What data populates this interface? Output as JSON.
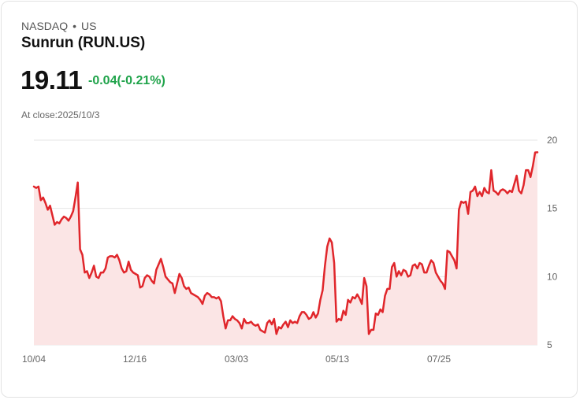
{
  "header": {
    "exchange": "NASDAQ",
    "separator": "•",
    "market": "US",
    "title": "Sunrun (RUN.US)",
    "price": "19.11",
    "change": "-0.04(-0.21%)",
    "close_label": "At close:2025/10/3"
  },
  "colors": {
    "line": "#e0262b",
    "fill": "#fbe5e5",
    "change": "#1fa34a",
    "grid": "#e6e6e6"
  },
  "chart_data": {
    "type": "area",
    "title": "",
    "xlabel": "",
    "ylabel": "",
    "ylim": [
      5,
      20
    ],
    "y_ticks": [
      "20",
      "15",
      "10",
      "5"
    ],
    "x_tick_labels": [
      "10/04",
      "12/16",
      "03/03",
      "05/13",
      "07/25"
    ],
    "grid": true,
    "axis_position": "right",
    "series": [
      {
        "values": [
          16.6,
          16.5,
          16.6,
          15.6,
          15.8,
          15.4,
          14.9,
          15.2,
          14.5,
          13.8,
          14.0,
          13.9,
          14.2,
          14.4,
          14.3,
          14.1,
          14.4,
          14.8,
          15.8,
          16.9,
          12.0,
          11.6,
          10.3,
          10.4,
          9.9,
          10.3,
          10.8,
          10.0,
          9.9,
          10.3,
          10.3,
          10.6,
          11.4,
          11.5,
          11.5,
          11.4,
          11.6,
          11.2,
          10.6,
          10.3,
          10.4,
          11.1,
          10.5,
          10.3,
          10.2,
          10.1,
          9.2,
          9.3,
          9.9,
          10.1,
          10.0,
          9.7,
          9.5,
          10.5,
          10.9,
          11.3,
          10.7,
          10.0,
          9.8,
          9.6,
          9.5,
          8.8,
          9.5,
          10.2,
          9.9,
          9.3,
          9.1,
          9.2,
          8.8,
          8.7,
          8.6,
          8.5,
          8.3,
          8.0,
          8.6,
          8.8,
          8.7,
          8.5,
          8.5,
          8.4,
          8.5,
          8.2,
          7.1,
          6.2,
          6.8,
          6.8,
          7.1,
          6.9,
          6.8,
          6.6,
          6.2,
          6.9,
          6.6,
          6.6,
          6.7,
          6.5,
          6.4,
          6.5,
          6.1,
          6.0,
          5.9,
          6.6,
          6.8,
          6.5,
          6.9,
          5.8,
          6.3,
          6.2,
          6.5,
          6.7,
          6.3,
          6.8,
          6.6,
          6.7,
          6.6,
          7.1,
          7.4,
          7.4,
          7.2,
          6.9,
          7.0,
          7.4,
          7.0,
          7.3,
          8.3,
          9.0,
          10.8,
          12.2,
          12.8,
          12.5,
          11.0,
          6.7,
          6.9,
          6.8,
          7.5,
          7.2,
          8.3,
          8.1,
          8.5,
          8.4,
          8.7,
          8.4,
          8.0,
          9.9,
          9.3,
          5.8,
          6.1,
          6.1,
          7.3,
          7.2,
          7.6,
          7.4,
          8.6,
          9.1,
          9.1,
          10.7,
          11.0,
          10.0,
          10.4,
          10.1,
          10.5,
          10.4,
          10.0,
          10.1,
          10.8,
          10.9,
          10.6,
          11.0,
          10.9,
          10.3,
          10.3,
          10.8,
          11.2,
          11.0,
          10.3,
          10.0,
          9.7,
          9.5,
          9.1,
          11.9,
          11.8,
          11.5,
          11.2,
          10.6,
          14.9,
          15.5,
          15.4,
          15.5,
          14.6,
          16.2,
          16.3,
          16.6,
          15.9,
          16.2,
          15.9,
          16.5,
          16.2,
          16.1,
          17.8,
          16.3,
          16.2,
          16.0,
          16.3,
          16.4,
          16.3,
          16.1,
          16.3,
          16.2,
          16.8,
          17.4,
          16.3,
          16.1,
          16.7,
          17.8,
          17.8,
          17.3,
          18.1,
          19.1,
          19.11
        ]
      }
    ]
  }
}
